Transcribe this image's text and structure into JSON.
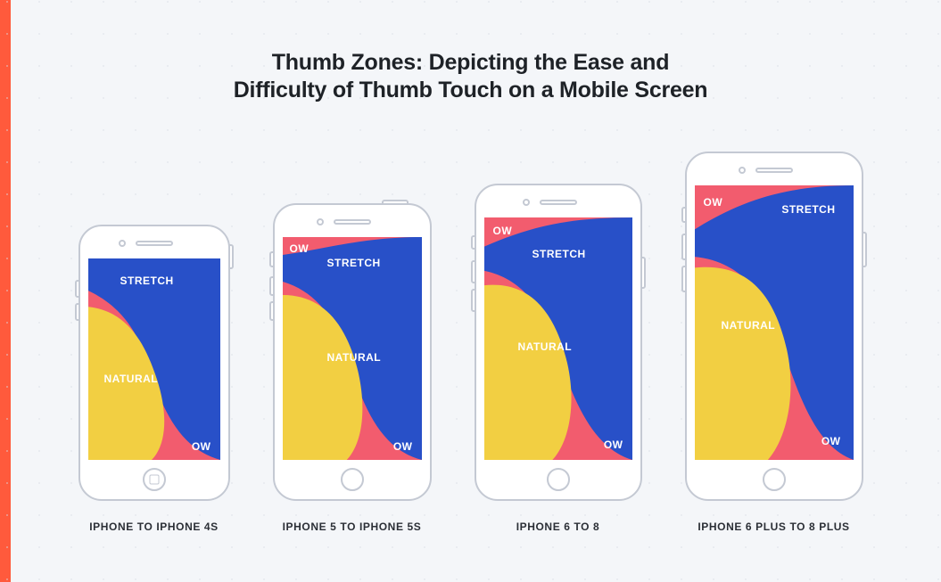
{
  "title_line1": "Thumb Zones: Depicting the Ease and",
  "title_line2": "Difficulty of Thumb Touch on a Mobile Screen",
  "zones": {
    "stretch": "STRETCH",
    "natural": "NATURAL",
    "ow": "OW"
  },
  "phones": [
    {
      "caption": "IPHONE TO IPHONE 4S"
    },
    {
      "caption": "IPHONE 5 TO IPHONE 5S"
    },
    {
      "caption": "IPHONE 6 TO 8"
    },
    {
      "caption": "IPHONE 6 PLUS TO 8 PLUS"
    }
  ],
  "colors": {
    "ow": "#f25c6e",
    "stretch": "#2850c8",
    "natural": "#f2cf42"
  }
}
